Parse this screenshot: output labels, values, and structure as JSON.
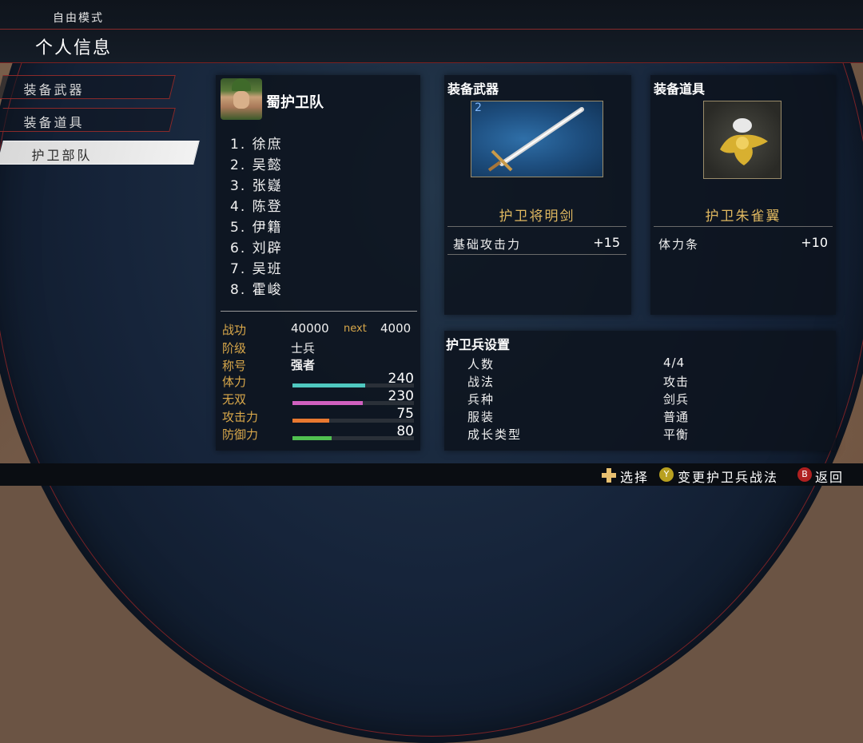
{
  "header": {
    "mode": "自由模式",
    "title": "个人信息"
  },
  "nav": {
    "items": [
      {
        "label": "装备武器"
      },
      {
        "label": "装备道具"
      },
      {
        "label": "护卫部队"
      }
    ]
  },
  "unit": {
    "name": "蜀护卫队",
    "members": [
      "1. 徐庶",
      "2. 吴懿",
      "3. 张嶷",
      "4. 陈登",
      "5. 伊籍",
      "6. 刘辟",
      "7. 吴班",
      "8. 霍峻"
    ]
  },
  "stats": {
    "zhangong_label": "战功",
    "zhangong_value": "40000",
    "next_label": "next",
    "next_value": "4000",
    "rank_label": "阶级",
    "rank_value": "士兵",
    "title_label": "称号",
    "title_value": "强者",
    "hp_label": "体力",
    "hp_value": "240",
    "musou_label": "无双",
    "musou_value": "230",
    "atk_label": "攻击力",
    "atk_value": "75",
    "def_label": "防御力",
    "def_value": "80",
    "hp_fill": 0.6,
    "musou_fill": 0.58,
    "atk_fill": 0.3,
    "def_fill": 0.32
  },
  "weapon": {
    "section_title": "装备武器",
    "level": "2",
    "name": "护卫将明剑",
    "attr_name": "基础攻击力",
    "attr_value": "+15"
  },
  "item": {
    "section_title": "装备道具",
    "name": "护卫朱雀翼",
    "attr_name": "体力条",
    "attr_value": "+10"
  },
  "guard_settings": {
    "title": "护卫兵设置",
    "rows": [
      {
        "key": "人数",
        "value": "4/4"
      },
      {
        "key": "战法",
        "value": "攻击"
      },
      {
        "key": "兵种",
        "value": "剑兵"
      },
      {
        "key": "服装",
        "value": "普通"
      },
      {
        "key": "成长类型",
        "value": "平衡"
      }
    ]
  },
  "footer": {
    "select_label": "选择",
    "y_button": "Y",
    "change_label": "变更护卫兵战法",
    "b_button": "B",
    "back_label": "返回"
  },
  "colors": {
    "hp": "#4fc8c0",
    "musou": "#d060c0",
    "atk": "#e87830",
    "def": "#50c050",
    "gold": "#d9a84a"
  }
}
